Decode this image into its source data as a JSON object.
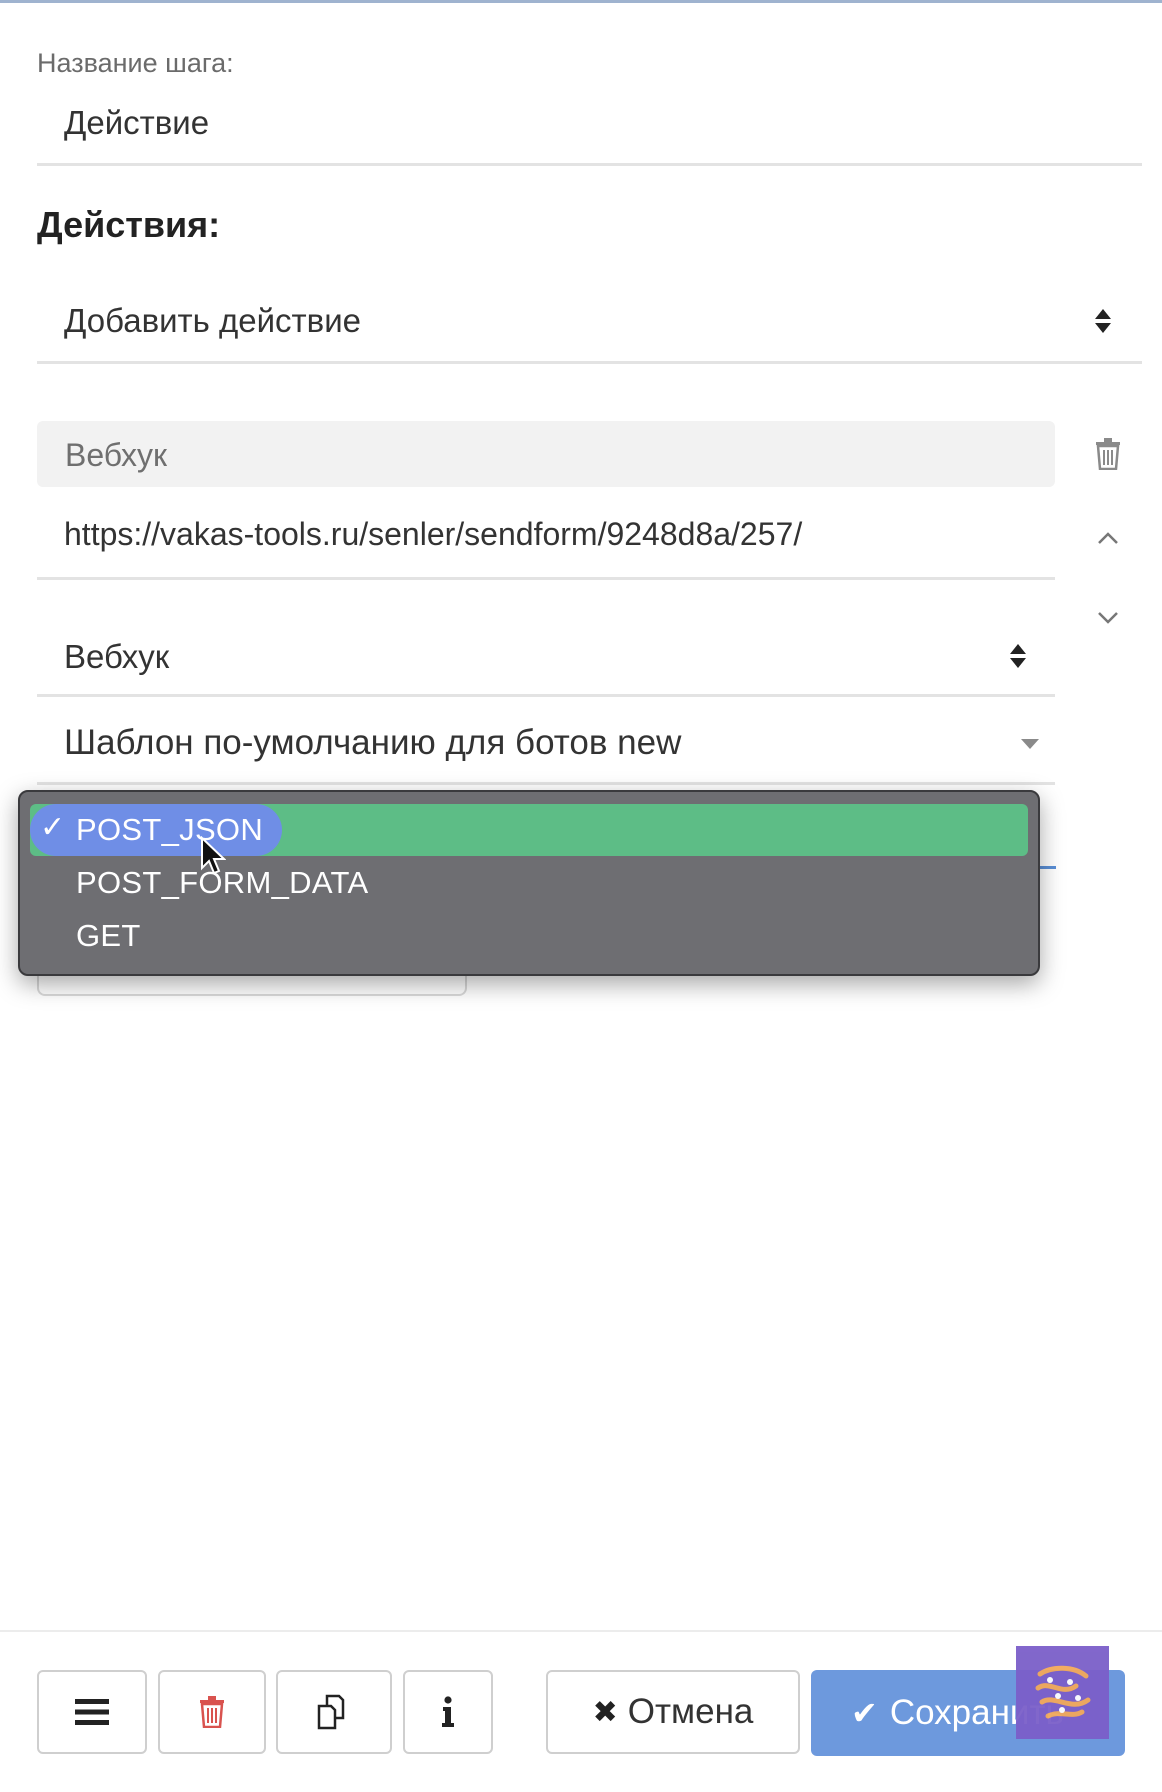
{
  "step": {
    "name_label": "Название шага:",
    "name_value": "Действие"
  },
  "actions": {
    "title": "Действия:",
    "add_select_value": "Добавить действие"
  },
  "action_item": {
    "type_title": "Вебхук",
    "url": "https://vakas-tools.ru/senler/sendform/9248d8a/257/",
    "type_select_value": "Вебхук",
    "template_select_value": "Шаблон по-умолчанию для ботов new"
  },
  "method_dropdown": {
    "options": [
      "POST_JSON",
      "POST_FORM_DATA",
      "GET"
    ],
    "selected": "POST_JSON",
    "check_mark": "✓"
  },
  "toolbar": {
    "cancel_label": "Отмена",
    "save_label": "Сохранить",
    "cancel_icon": "✖",
    "save_icon": "✔"
  },
  "colors": {
    "accent_blue": "#6d99dd",
    "selected_green": "#5dbd86",
    "selected_pill": "#6f8ee6",
    "danger_red": "#d9534f"
  }
}
